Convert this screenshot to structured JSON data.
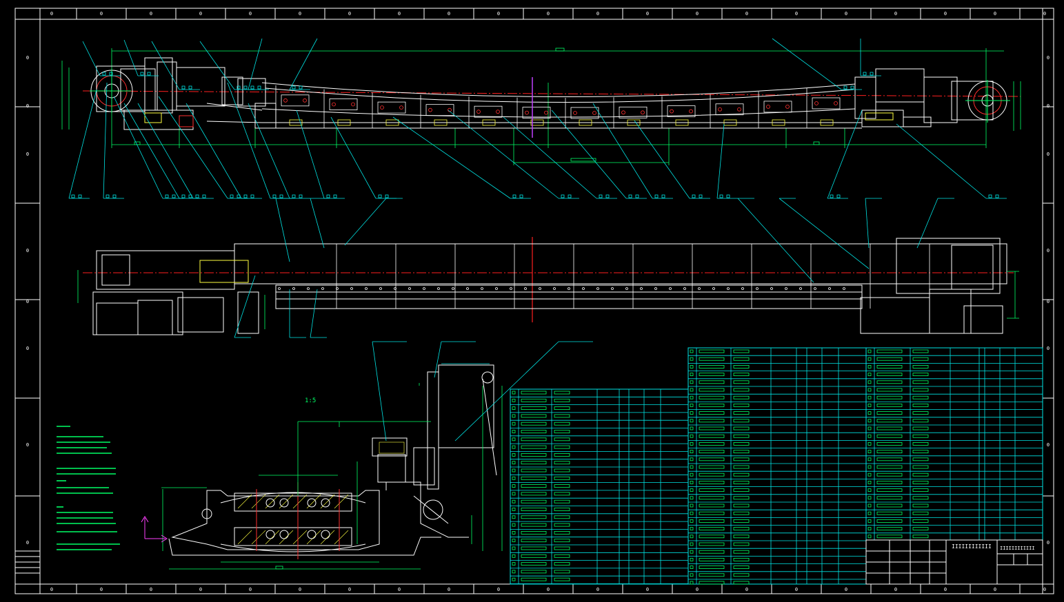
{
  "drawing": {
    "view_label_section": "1:5",
    "colors": {
      "background": "#000000",
      "frame": "#ffffff",
      "outline": "#ffffff",
      "centerline": "#ff2020",
      "dimension": "#00ff66",
      "leader": "#00e5e5",
      "table": "#00e5e5",
      "part_yellow": "#ffff40",
      "axis_magenta": "#ff40ff",
      "center_magenta": "#c040ff"
    }
  },
  "frame": {
    "top_zones": [
      "0",
      "0",
      "0",
      "0",
      "0",
      "0",
      "0",
      "0",
      "0",
      "0",
      "0",
      "0",
      "0",
      "0",
      "0",
      "0",
      "0",
      "0",
      "0",
      "0",
      "0"
    ],
    "bottom_zones": [
      "0",
      "0",
      "0",
      "0",
      "0",
      "0",
      "0",
      "0",
      "0",
      "0",
      "0",
      "0",
      "0",
      "0",
      "0",
      "0",
      "0",
      "0",
      "0",
      "0",
      "0"
    ],
    "left_zones": [
      "0",
      "0",
      "0",
      "0",
      "0",
      "0",
      "0",
      "0"
    ],
    "right_zones": [
      "0",
      "0",
      "0",
      "0",
      "0",
      "0",
      "0",
      "0"
    ]
  },
  "title_block": {
    "scale_marks": "IIIIIIIIIIII",
    "sheet_marks": "IIIIIIIIIIII"
  }
}
